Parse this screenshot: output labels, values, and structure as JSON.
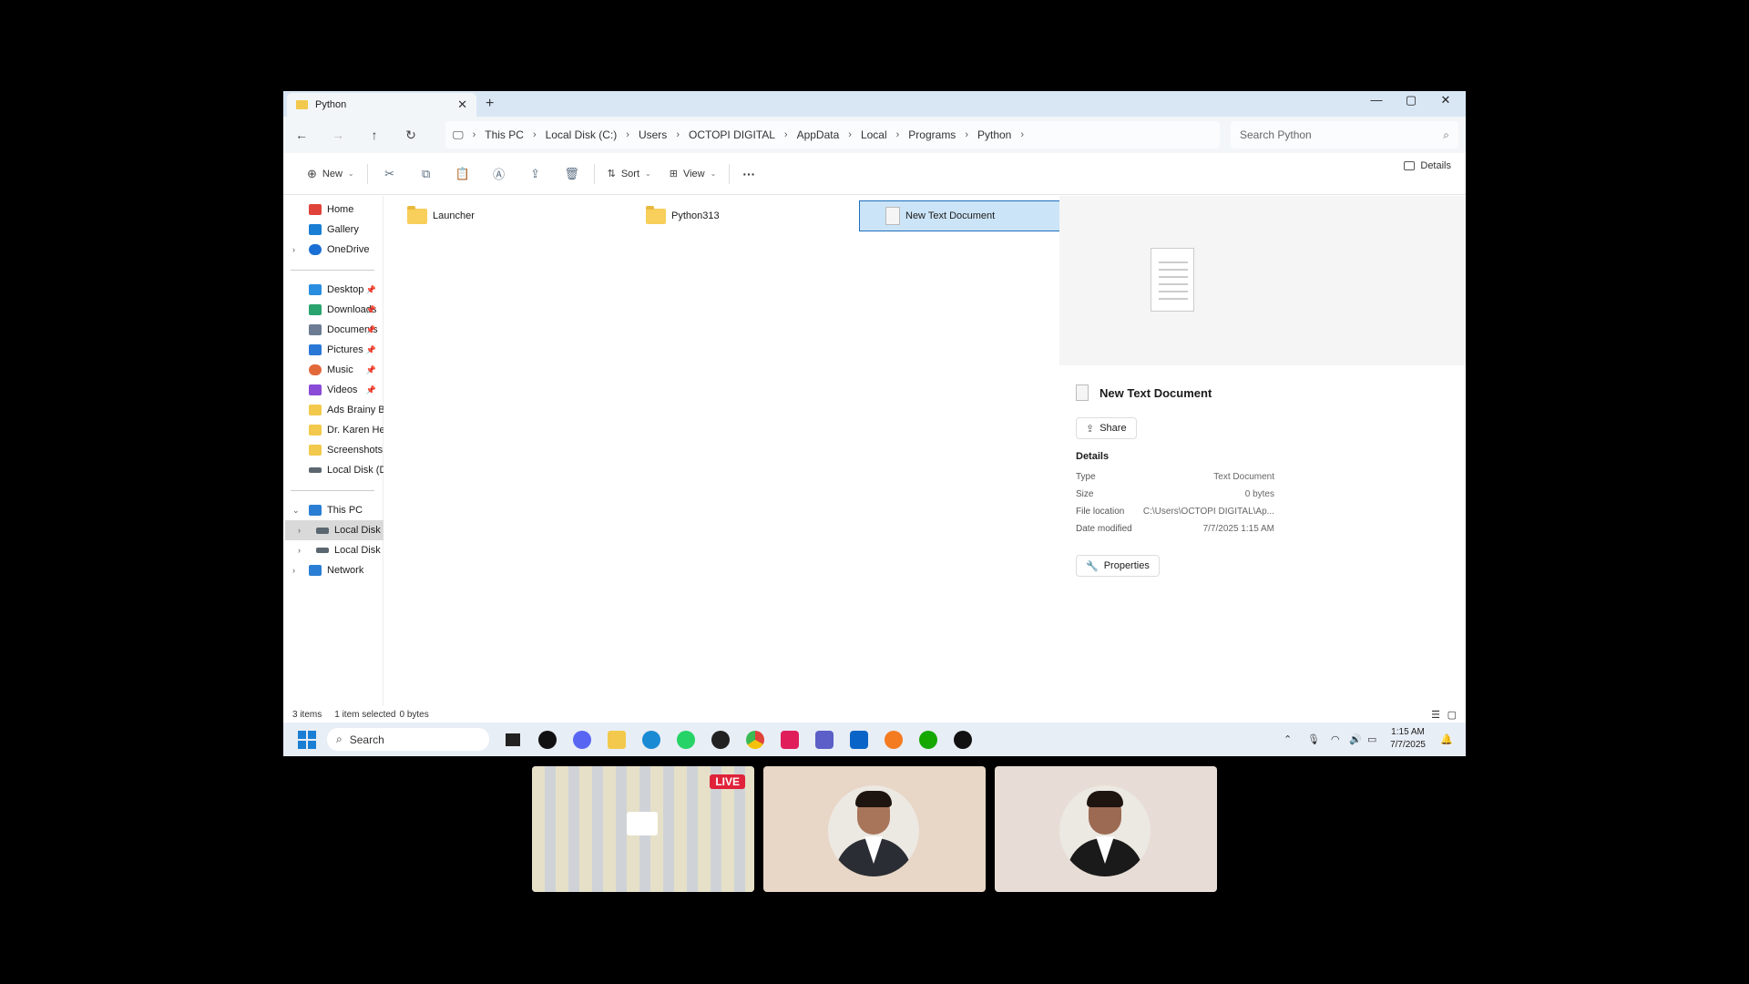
{
  "window": {
    "tab_title": "Python",
    "new_tab_symbol": "+",
    "controls": {
      "minimize": "—",
      "maximize": "▢",
      "close": "✕"
    }
  },
  "nav": {
    "breadcrumbs": [
      "This PC",
      "Local Disk (C:)",
      "Users",
      "OCTOPI DIGITAL",
      "AppData",
      "Local",
      "Programs",
      "Python"
    ],
    "search_placeholder": "Search Python"
  },
  "toolbar": {
    "new_label": "New",
    "sort_label": "Sort",
    "view_label": "View",
    "more_label": "···",
    "details_label": "Details"
  },
  "sidebar": {
    "top": [
      {
        "label": "Home",
        "color": "#e0433a"
      },
      {
        "label": "Gallery",
        "color": "#1a7fd4"
      },
      {
        "label": "OneDrive",
        "color": "#1a6fd4"
      }
    ],
    "quick": [
      {
        "label": "Desktop",
        "color": "#2a8ee0",
        "pinned": true
      },
      {
        "label": "Downloads",
        "color": "#2aa36e",
        "pinned": true
      },
      {
        "label": "Documents",
        "color": "#6b7c93",
        "pinned": true
      },
      {
        "label": "Pictures",
        "color": "#2a78d6",
        "pinned": true
      },
      {
        "label": "Music",
        "color": "#e2683a",
        "pinned": true
      },
      {
        "label": "Videos",
        "color": "#8a4bd6",
        "pinned": true
      },
      {
        "label": "Ads Brainy Box Pacl",
        "color": "#f2c94c",
        "pinned": false
      },
      {
        "label": "Dr. Karen Hero Sec",
        "color": "#f2c94c",
        "pinned": false
      },
      {
        "label": "Screenshots",
        "color": "#f2c94c",
        "pinned": false
      },
      {
        "label": "Local Disk (D:)",
        "color": "#5b6770",
        "pinned": false
      }
    ],
    "pin_symbol": "📌",
    "tree": [
      {
        "label": "This PC",
        "color": "#2a7fd4",
        "chevron": "⌄"
      },
      {
        "label": "Local Disk (C:)",
        "color": "#5b6770",
        "chevron": "›"
      },
      {
        "label": "Local Disk (D:)",
        "color": "#5b6770",
        "chevron": "›"
      },
      {
        "label": "Network",
        "color": "#2a7fd4",
        "chevron": "›"
      }
    ]
  },
  "files": [
    {
      "name": "Launcher",
      "kind": "folder"
    },
    {
      "name": "Python313",
      "kind": "folder"
    },
    {
      "name": "New Text Document",
      "kind": "text"
    }
  ],
  "preview": {
    "title": "New Text Document",
    "share_label": "Share",
    "details_heading": "Details",
    "rows": [
      {
        "k": "Type",
        "v": "Text Document"
      },
      {
        "k": "Size",
        "v": "0 bytes"
      },
      {
        "k": "File location",
        "v": "C:\\Users\\OCTOPI DIGITAL\\Ap..."
      },
      {
        "k": "Date modified",
        "v": "7/7/2025 1:15 AM"
      }
    ],
    "properties_label": "Properties"
  },
  "status": {
    "count": "3 items",
    "selected": "1 item selected",
    "size": "0 bytes"
  },
  "taskbar": {
    "search_label": "Search",
    "time": "1:15 AM",
    "date": "7/7/2025",
    "apps": [
      {
        "name": "explorer-dark-icon",
        "color": "#222"
      },
      {
        "name": "github-icon",
        "color": "#111"
      },
      {
        "name": "discord-icon",
        "color": "#5865f2"
      },
      {
        "name": "file-explorer-icon",
        "color": "#f2c94c"
      },
      {
        "name": "edge-icon",
        "color": "#1a8ad4"
      },
      {
        "name": "whatsapp-icon",
        "color": "#25d366"
      },
      {
        "name": "chatgpt-icon",
        "color": "#222"
      },
      {
        "name": "chrome-icon",
        "color": "#e0433a"
      },
      {
        "name": "slack-icon",
        "color": "#e01e5a"
      },
      {
        "name": "teams-icon",
        "color": "#5b5fc7"
      },
      {
        "name": "outlook-icon",
        "color": "#0a64c8"
      },
      {
        "name": "app-orange-icon",
        "color": "#f47b20"
      },
      {
        "name": "upwork-green-icon",
        "color": "#14a800"
      },
      {
        "name": "upwork-icon",
        "color": "#111"
      }
    ]
  },
  "meeting": {
    "live_label": "LIVE"
  }
}
